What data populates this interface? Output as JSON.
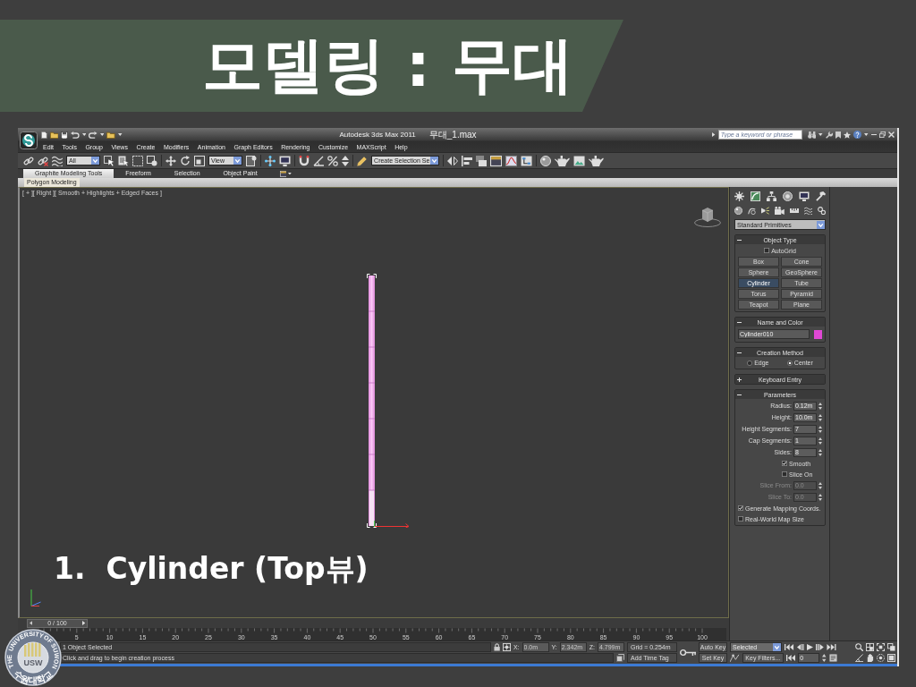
{
  "slide": {
    "title": "모델링 : 무대",
    "caption": "1.  Cylinder (Top뷰)"
  },
  "title_bar": {
    "app_name": "Autodesk 3ds Max  2011",
    "file_name": "무대_1.max",
    "search": {
      "placeholder": "Type a keyword or phrase"
    }
  },
  "menu": [
    "Edit",
    "Tools",
    "Group",
    "Views",
    "Create",
    "Modifiers",
    "Animation",
    "Graph Editors",
    "Rendering",
    "Customize",
    "MAXScript",
    "Help"
  ],
  "toolbar": {
    "selection_filter": "All",
    "reference_coordinate_system": "View",
    "named_selection_set": "Create Selection Se"
  },
  "ribbon": {
    "tabs": [
      {
        "label": "Graphite Modeling Tools",
        "selected": true
      },
      {
        "label": "Freeform",
        "selected": false
      },
      {
        "label": "Selection",
        "selected": false
      },
      {
        "label": "Object Paint",
        "selected": false
      }
    ],
    "panel": "Polygon Modeling"
  },
  "viewport": {
    "label": "[ + ][ Right ][ Smooth + Highlights + Edged Faces ]"
  },
  "command_panel": {
    "category": "Standard Primitives",
    "rollouts": [
      {
        "kind": "buttons",
        "title": "Object Type",
        "expanded": true,
        "autogrid": {
          "label": "AutoGrid",
          "checked": false
        },
        "buttons": [
          {
            "label": "Box",
            "selected": false
          },
          {
            "label": "Cone",
            "selected": false
          },
          {
            "label": "Sphere",
            "selected": false
          },
          {
            "label": "GeoSphere",
            "selected": false
          },
          {
            "label": "Cylinder",
            "selected": true
          },
          {
            "label": "Tube",
            "selected": false
          },
          {
            "label": "Torus",
            "selected": false
          },
          {
            "label": "Pyramid",
            "selected": false
          },
          {
            "label": "Teapot",
            "selected": false
          },
          {
            "label": "Plane",
            "selected": false
          }
        ]
      },
      {
        "kind": "name",
        "title": "Name and Color",
        "expanded": true,
        "name": "Cylinder010",
        "color": "#e048d4"
      },
      {
        "kind": "radios",
        "title": "Creation Method",
        "expanded": true,
        "options": [
          {
            "label": "Edge",
            "selected": false
          },
          {
            "label": "Center",
            "selected": true
          }
        ]
      },
      {
        "title": "Keyboard Entry",
        "expanded": false
      },
      {
        "kind": "params",
        "title": "Parameters",
        "expanded": true,
        "items": [
          {
            "kind": "spinner",
            "label": "Radius:",
            "value": "0.12m",
            "disabled": false
          },
          {
            "kind": "spinner",
            "label": "Height:",
            "value": "10.0m",
            "disabled": false
          },
          {
            "kind": "spinner",
            "label": "Height Segments:",
            "value": "7",
            "disabled": false
          },
          {
            "kind": "spinner",
            "label": "Cap Segments:",
            "value": "1",
            "disabled": false
          },
          {
            "kind": "spinner",
            "label": "Sides:",
            "value": "8",
            "disabled": false
          },
          {
            "kind": "toggle",
            "label": "Smooth",
            "checked": true
          },
          {
            "kind": "toggle",
            "label": "Slice On",
            "checked": false
          },
          {
            "kind": "spinner",
            "label": "Slice From:",
            "value": "0.0",
            "disabled": true
          },
          {
            "kind": "spinner",
            "label": "Slice To:",
            "value": "0.0",
            "disabled": true
          },
          {
            "kind": "checkbox",
            "label": "Generate Mapping Coords.",
            "checked": true
          },
          {
            "kind": "checkbox",
            "label": "Real-World Map Size",
            "checked": false
          }
        ]
      }
    ]
  },
  "time_slider": {
    "position": "0 / 100",
    "level": 0
  },
  "track_bar": {
    "labels": [
      "5",
      "10",
      "15",
      "20",
      "25",
      "30",
      "35",
      "40",
      "45",
      "50",
      "55",
      "60",
      "65",
      "70",
      "75",
      "80",
      "85",
      "90",
      "95",
      "100"
    ]
  },
  "status_bar": {
    "selection": "1 Object Selected",
    "prompt": "Click and drag to begin creation process",
    "coordinates": [
      {
        "axis": "X:",
        "value": "0.0m"
      },
      {
        "axis": "Y:",
        "value": "2.342m"
      },
      {
        "axis": "Z:",
        "value": "4.799m"
      }
    ],
    "grid": "Grid = 0.254m",
    "time_tag": "Add Time Tag"
  },
  "animation_controls": {
    "auto_key": "Auto Key",
    "key_set": "Selected",
    "set_key": "Set Key",
    "key_filters": "Key Filters...",
    "frame": "0"
  },
  "logo": {
    "ring_text": [
      "THE",
      "UNIVERSITY",
      "OF",
      "SUWON"
    ],
    "initials": "USW",
    "korean": "수원대학교"
  }
}
